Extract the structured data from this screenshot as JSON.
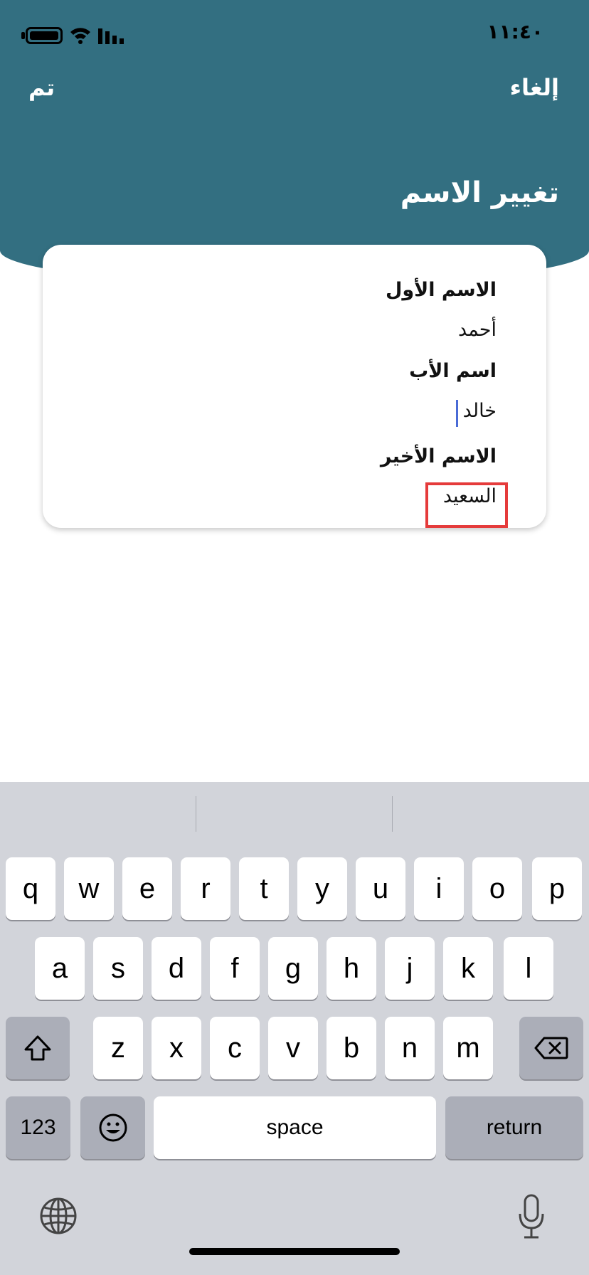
{
  "status_bar": {
    "time": "١١:٤٠"
  },
  "nav": {
    "cancel_label": "إلغاء",
    "done_label": "تم",
    "title": "تغيير الاسم"
  },
  "form": {
    "first_name": {
      "label": "الاسم الأول",
      "value": "أحمد"
    },
    "father_name": {
      "label": "اسم الأب",
      "value": "خالد"
    },
    "last_name": {
      "label": "الاسم الأخير",
      "value": "السعيد"
    }
  },
  "keyboard": {
    "row1": [
      "q",
      "w",
      "e",
      "r",
      "t",
      "y",
      "u",
      "i",
      "o",
      "p"
    ],
    "row2": [
      "a",
      "s",
      "d",
      "f",
      "g",
      "h",
      "j",
      "k",
      "l"
    ],
    "row3": [
      "z",
      "x",
      "c",
      "v",
      "b",
      "n",
      "m"
    ],
    "numbers_label": "123",
    "space_label": "space",
    "return_label": "return"
  },
  "icons": {
    "shift": "shift-icon",
    "backspace": "backspace-icon",
    "emoji": "emoji-icon",
    "globe": "globe-icon",
    "microphone": "microphone-icon",
    "battery": "battery-icon",
    "wifi": "wifi-icon",
    "signal": "signal-icon"
  },
  "colors": {
    "header": "#336f81",
    "highlight": "#e53b3b",
    "cursor": "#4a6bd6",
    "keyboard_bg": "#d2d4da"
  }
}
